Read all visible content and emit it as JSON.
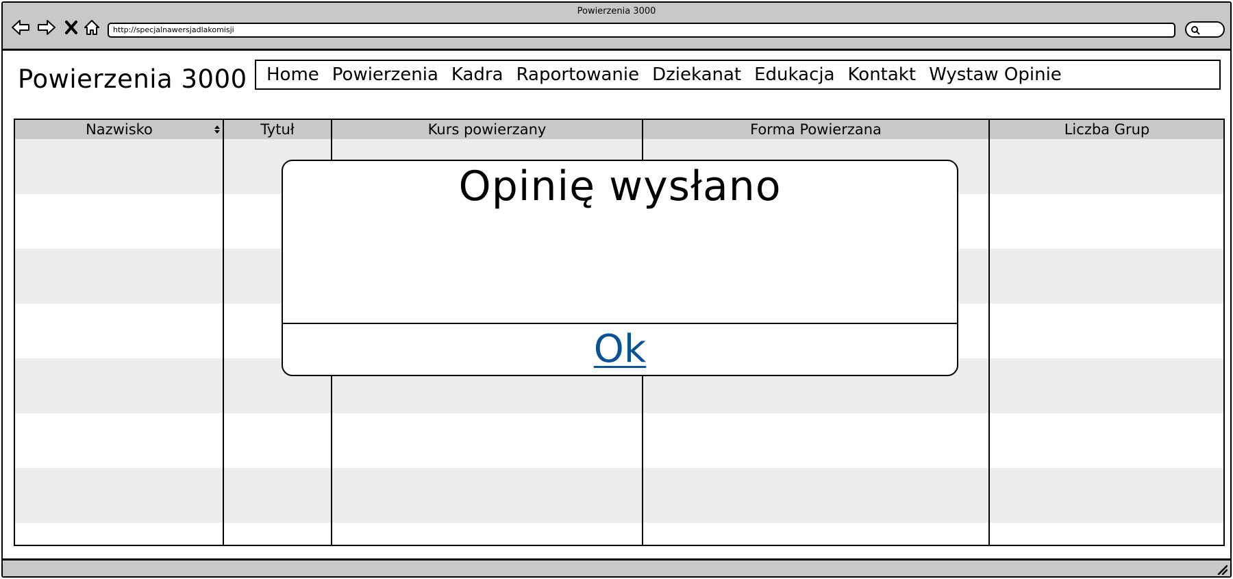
{
  "browser": {
    "window_title": "Powierzenia 3000",
    "url": "http://specjalnawersjadlakomisji",
    "icons": [
      "back-icon",
      "forward-icon",
      "stop-icon",
      "home-icon",
      "search-icon"
    ]
  },
  "header": {
    "site_title": "Powierzenia 3000"
  },
  "menu": {
    "items": [
      "Home",
      "Powierzenia",
      "Kadra",
      "Raportowanie",
      "Dziekanat",
      "Edukacja",
      "Kontakt",
      "Wystaw Opinie"
    ]
  },
  "table": {
    "columns": [
      "Nazwisko",
      "Tytuł",
      "Kurs powierzany",
      "Forma Powierzana",
      "Liczba Grup"
    ],
    "sortable_column": "Nazwisko",
    "row_count": 8,
    "colors": {
      "header": "#c9c9c9",
      "stripe": "#ececec"
    }
  },
  "modal": {
    "title": "Opinię wysłano",
    "ok_label": "Ok",
    "link_color": "#0b5394"
  }
}
